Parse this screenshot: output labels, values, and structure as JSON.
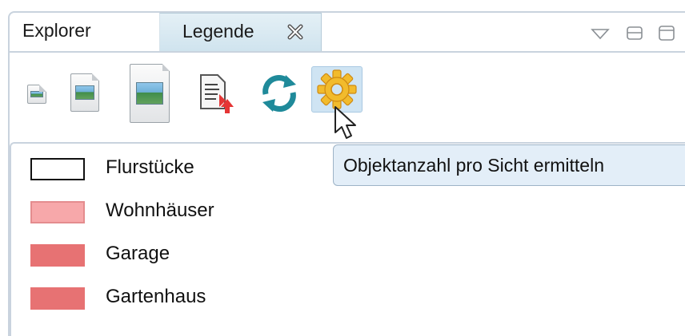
{
  "tabs": [
    {
      "label": "Explorer",
      "active": false
    },
    {
      "label": "Legende",
      "active": true
    }
  ],
  "toolbar": {
    "buttons": [
      {
        "name": "small-image-icon"
      },
      {
        "name": "medium-image-icon"
      },
      {
        "name": "large-image-icon"
      },
      {
        "name": "export-document-icon"
      },
      {
        "name": "refresh-icon"
      },
      {
        "name": "gear-icon",
        "hovered": true
      }
    ]
  },
  "tooltip": {
    "text": "Objektanzahl pro Sicht ermitteln"
  },
  "legend": {
    "items": [
      {
        "label": "Flurstücke",
        "fill": "#ffffff",
        "stroke": "#111111"
      },
      {
        "label": "Wohnhäuser",
        "fill": "#f7a8aa",
        "stroke": "#e48c8e"
      },
      {
        "label": "Garage",
        "fill": "#e77273",
        "stroke": "#e77273"
      },
      {
        "label": "Gartenhaus",
        "fill": "#e77273",
        "stroke": "#e77273"
      }
    ]
  },
  "colors": {
    "tab_active": "#d8e9f2",
    "border": "#c9d3de",
    "tooltip_bg": "#e3eef8",
    "gear_hover_bg": "#cfe4f3"
  }
}
